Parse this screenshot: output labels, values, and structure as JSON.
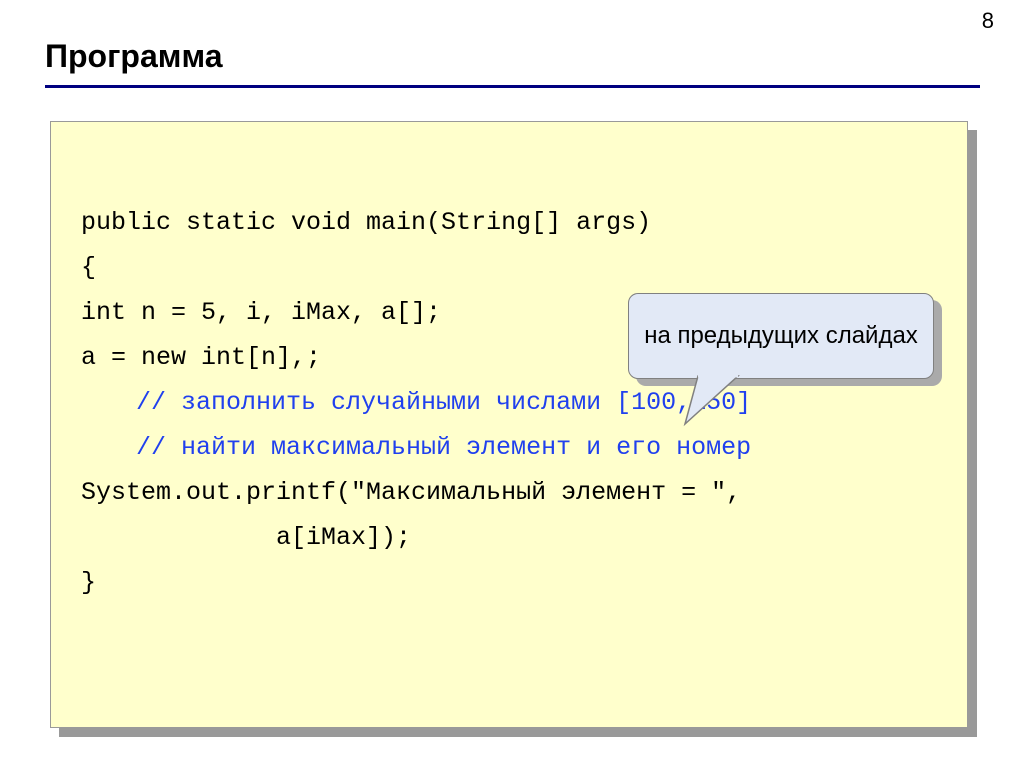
{
  "page_number": "8",
  "title": "Программа",
  "code": {
    "line1": "public static void main(String[] args)",
    "line2": "{",
    "line3": "int n = 5, i, iMax, a[];",
    "line4": "a = new int[n],;",
    "comment1": "// заполнить случайными числами [100,150]",
    "comment2": "// найти максимальный элемент и его номер",
    "line5": "System.out.printf(\"Максимальный элемент = \",",
    "line6": "a[iMax]);",
    "line7": "}"
  },
  "callout": {
    "text": "на предыдущих слайдах"
  }
}
